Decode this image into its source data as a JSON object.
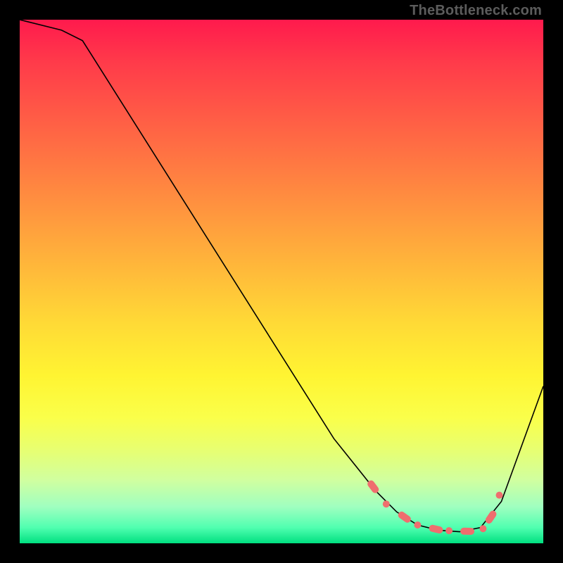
{
  "watermark": "TheBottleneck.com",
  "colors": {
    "page_bg": "#000000",
    "marker": "#ef6e6e",
    "curve": "#000000"
  },
  "chart_data": {
    "type": "line",
    "title": "",
    "xlabel": "",
    "ylabel": "",
    "xlim": [
      0,
      100
    ],
    "ylim": [
      0,
      100
    ],
    "x": [
      0,
      8,
      12,
      60,
      68,
      72,
      76,
      80,
      84,
      88,
      92,
      100
    ],
    "values": [
      100,
      98,
      96,
      20,
      10,
      6,
      3.5,
      2.5,
      2.2,
      3,
      8,
      30
    ],
    "markers": {
      "x": [
        67.5,
        70.0,
        73.5,
        76.0,
        79.5,
        82.0,
        85.5,
        88.5,
        90.0,
        91.6
      ],
      "y": [
        10.8,
        7.5,
        5.0,
        3.5,
        2.7,
        2.4,
        2.3,
        2.8,
        5.0,
        9.2
      ]
    }
  }
}
